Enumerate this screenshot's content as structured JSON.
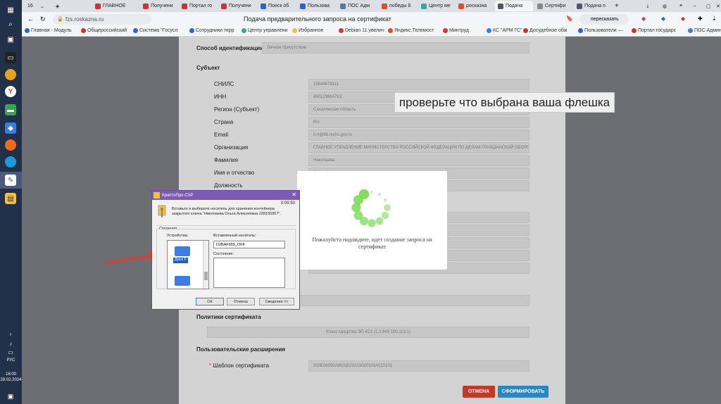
{
  "tabs": {
    "counter": "16",
    "items": [
      {
        "label": "ГЛАВНОЕ",
        "color": "#c33"
      },
      {
        "label": "Получени",
        "color": "#c33"
      },
      {
        "label": "Портал го",
        "color": "#c33"
      },
      {
        "label": "Получени",
        "color": "#c33"
      },
      {
        "label": "Поиск об",
        "color": "#2a63c9"
      },
      {
        "label": "Пользова",
        "color": "#2a63c9"
      },
      {
        "label": "ПОС Адм",
        "color": "#5577aa"
      },
      {
        "label": "победы 8",
        "color": "#e04a2f"
      },
      {
        "label": "Центр ме",
        "color": "#3a9"
      },
      {
        "label": "росказна",
        "color": "#e04a2f"
      },
      {
        "label": "Подача",
        "color": "#556"
      },
      {
        "label": "Сертифи",
        "color": "#888"
      },
      {
        "label": "Подача п",
        "color": "#556"
      }
    ]
  },
  "address": {
    "url": "fzs.roskazna.ru",
    "page_title": "Подача предварительного запроса на сертификат",
    "translate": "пересказать"
  },
  "bookmarks": [
    "Главная - Модуль",
    "Общероссийский",
    "Система \"Госусл",
    "Сотрудники терр",
    "Центр управлени",
    "Избранное",
    "Debian 11 увелич",
    "Яндекс.Телемост",
    "Минтруд",
    "КС \"АРМ ГС\"",
    "Досудебное обж",
    "Пользователи —",
    "Портал государс",
    "ПОС Администр"
  ],
  "taskbar": {
    "lang": "РУС",
    "time": "16:00",
    "date": "28.02.2024"
  },
  "form": {
    "ident_label": "Способ идентификации",
    "ident_value": "Личное присутствие",
    "subject_header": "Субъект",
    "fields": [
      {
        "label": "СНИЛС",
        "value": "15844679111"
      },
      {
        "label": "ИНН",
        "value": "660123664763"
      },
      {
        "label": "Регион (Субъект)",
        "value": "Сахалинская область"
      },
      {
        "label": "Страна",
        "value": "RU"
      },
      {
        "label": "Email",
        "value": "it-4@65.mchs.gov.ru"
      },
      {
        "label": "Организация",
        "value": "ГЛАВНОЕ УПРАВЛЕНИЕ МИНИСТЕРСТВА РОССИЙСКОЙ ФЕДЕРАЦИИ ПО ДЕЛАМ ГРАЖДАНСКОЙ ОБОРОНЫ"
      },
      {
        "label": "Фамилия",
        "value": "Николаева"
      },
      {
        "label": "Имя и отчество",
        "value": "Ольга Алексеевна"
      },
      {
        "label": "Должность",
        "value": ""
      }
    ],
    "policies_header": "Политики сертификата",
    "policies_value": "Класс средства ЭП КС1 (1.2.643.100.113.1)",
    "ext_header": "Пользовательские расширения",
    "template_label": "Шаблон сертификата",
    "template_value": "300E06092A8503020101020102A020101",
    "cancel_label": "ОТМЕНА",
    "submit_label": "СФОРМИРОВАТЬ",
    "cancel_color": "#c0392b",
    "submit_color": "#2e86c1"
  },
  "hint": "проверьте что выбрана ваша флешка",
  "loader": {
    "message": "Пожалуйста подождите, идет создание запроса на сертификат",
    "spinner_color": "#7ed957"
  },
  "dialog": {
    "title": "КриптоПро CSP",
    "timer": "0:09:50",
    "instruction": "Вставьте и выберите носитель для хранения контейнера закрытого ключа \"Николаева Ольга Алексеевна 228155957\".",
    "group_label": "Сведения",
    "devices_label": "Устройства:",
    "device_selected": "Диск F",
    "inserted_label": "Вставленный носитель:",
    "inserted_value": "D2BAF655_OFF",
    "state_label": "Состояние:",
    "ok": "ОК",
    "cancel": "Отмена",
    "details": "Сведения <<"
  }
}
